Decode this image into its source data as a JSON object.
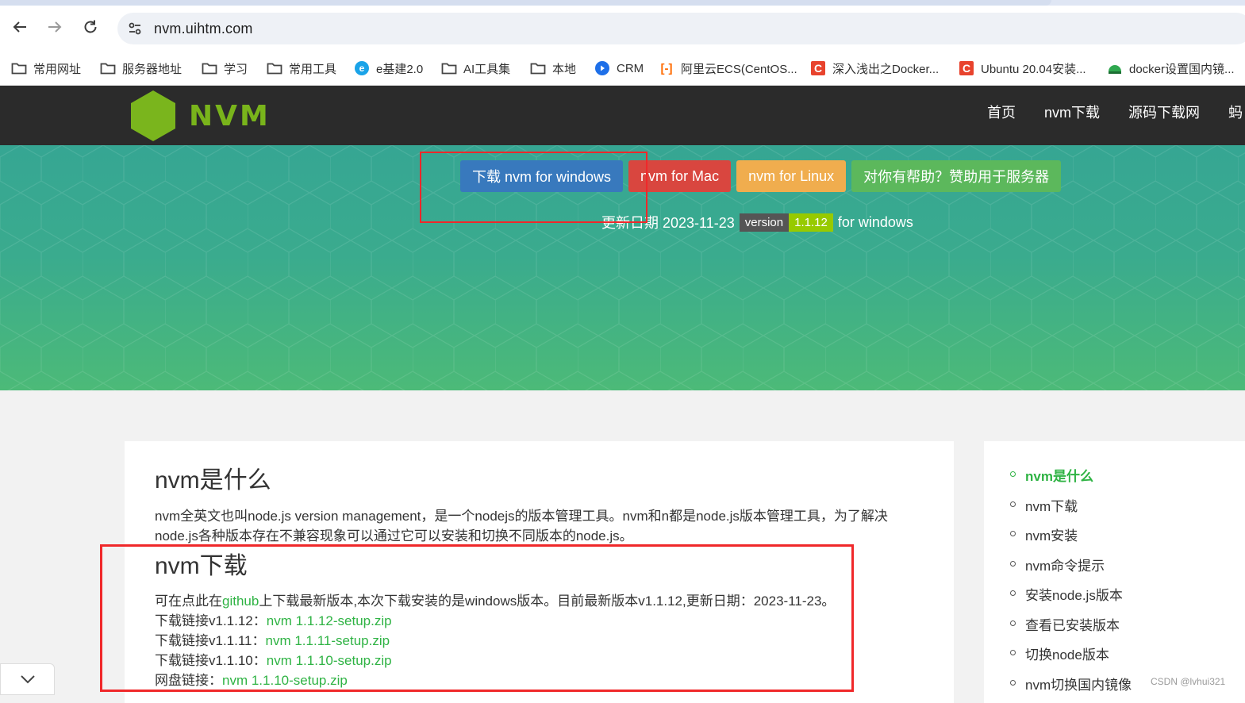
{
  "browser": {
    "url": "nvm.uihtm.com",
    "bookmarks": [
      {
        "label": "常用网址",
        "icon": "folder-icon"
      },
      {
        "label": "服务器地址",
        "icon": "folder-icon"
      },
      {
        "label": "学习",
        "icon": "folder-icon"
      },
      {
        "label": "常用工具",
        "icon": "folder-icon"
      },
      {
        "label": "e基建2.0",
        "icon": "e-favicon"
      },
      {
        "label": "AI工具集",
        "icon": "folder-icon"
      },
      {
        "label": "本地",
        "icon": "folder-icon"
      },
      {
        "label": "CRM",
        "icon": "crm-favicon"
      },
      {
        "label": "阿里云ECS(CentOS...",
        "icon": "aliyun-favicon"
      },
      {
        "label": "深入浅出之Docker...",
        "icon": "csdn-favicon"
      },
      {
        "label": "Ubuntu 20.04安装...",
        "icon": "csdn-favicon"
      },
      {
        "label": "docker设置国内镜...",
        "icon": "huan-favicon"
      }
    ]
  },
  "site": {
    "logo_text": "NVM",
    "nav": [
      "首页",
      "nvm下载",
      "源码下载网",
      "蚂"
    ],
    "brand_color": "#79b41b"
  },
  "hero": {
    "buttons": {
      "windows": "下载 nvm for windows",
      "mac": "nvm for Mac",
      "linux": "nvm for Linux",
      "donate": "对你有帮助？赞助用于服务器"
    },
    "update_label": "更新日期 2023-11-23",
    "version_label": "version",
    "version_value": "1.1.12",
    "platform": "for windows"
  },
  "main": {
    "what_title": "nvm是什么",
    "what_para": "nvm全英文也叫node.js version management，是一个nodejs的版本管理工具。nvm和n都是node.js版本管理工具，为了解决node.js各种版本存在不兼容现象可以通过它可以安装和切换不同版本的node.js。",
    "download_title": "nvm下载",
    "intro_before": "可在点此在",
    "intro_link": "github",
    "intro_after": "上下载最新版本,本次下载安装的是windows版本。目前最新版本v1.1.12,更新日期：2023-11-23。",
    "links": [
      {
        "label": "下载链接v1.1.12：",
        "file": "nvm 1.1.12-setup.zip"
      },
      {
        "label": "下载链接v1.1.11：",
        "file": "nvm 1.1.11-setup.zip"
      },
      {
        "label": "下载链接v1.1.10：",
        "file": "nvm 1.1.10-setup.zip"
      },
      {
        "label": "网盘链接：",
        "file": "nvm 1.1.10-setup.zip"
      }
    ]
  },
  "toc": [
    "nvm是什么",
    "nvm下载",
    "nvm安装",
    "nvm命令提示",
    "安装node.js版本",
    "查看已安装版本",
    "切换node版本",
    "nvm切换国内镜像"
  ],
  "watermark": "CSDN @lvhui321"
}
